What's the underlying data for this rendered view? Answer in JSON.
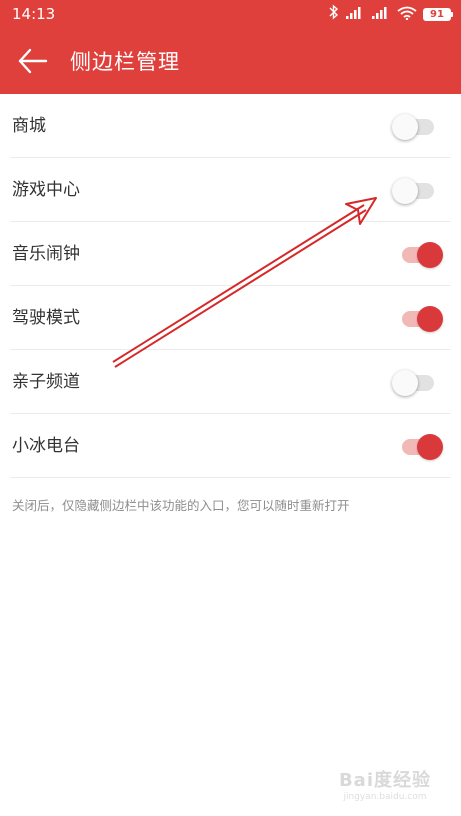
{
  "status_bar": {
    "time": "14:13",
    "battery": "91",
    "icons": [
      "bluetooth-icon",
      "signal-icon",
      "signal-icon",
      "wifi-icon",
      "battery-icon"
    ]
  },
  "header": {
    "title": "侧边栏管理",
    "back_icon": "arrow-left-icon"
  },
  "settings": [
    {
      "label": "商城",
      "enabled": false
    },
    {
      "label": "游戏中心",
      "enabled": false
    },
    {
      "label": "音乐闹钟",
      "enabled": true
    },
    {
      "label": "驾驶模式",
      "enabled": true
    },
    {
      "label": "亲子频道",
      "enabled": false
    },
    {
      "label": "小冰电台",
      "enabled": true
    }
  ],
  "footer_note": "关闭后，仅隐藏侧边栏中该功能的入口，您可以随时重新打开",
  "annotation": {
    "type": "red-arrow",
    "points_to": "游戏中心"
  },
  "watermark": {
    "text": "Bai度经验",
    "subtext": "jingyan.baidu.com"
  },
  "colors": {
    "accent": "#e0403c",
    "toggle_on_thumb": "#d9393a",
    "toggle_on_track": "#f2b8b5",
    "toggle_off_thumb": "#fafafa",
    "toggle_off_track": "#e2e2e2"
  }
}
